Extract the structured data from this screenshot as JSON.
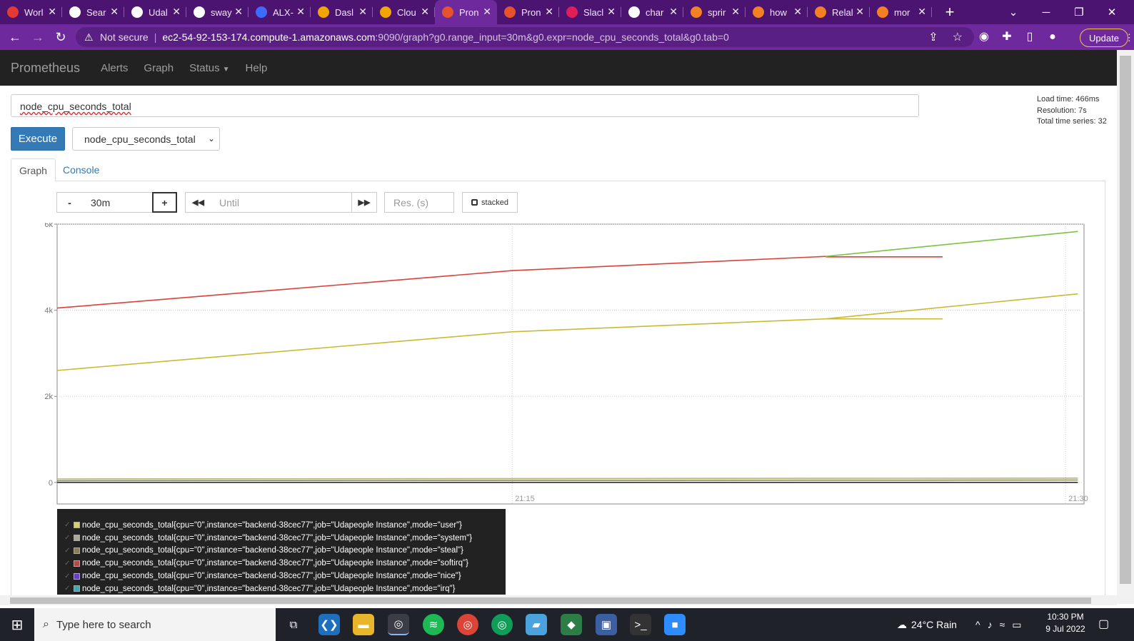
{
  "browser": {
    "tabs": [
      {
        "title": "Worl",
        "color": "#e53935",
        "active": false
      },
      {
        "title": "Sear",
        "color": "#ffffff",
        "active": false
      },
      {
        "title": "Udal",
        "color": "#ffffff",
        "active": false
      },
      {
        "title": "sway",
        "color": "#ffffff",
        "active": false
      },
      {
        "title": "ALX-",
        "color": "#3d6bff",
        "active": false
      },
      {
        "title": "Dasl",
        "color": "#f0a500",
        "active": false
      },
      {
        "title": "Clou",
        "color": "#f0a500",
        "active": false
      },
      {
        "title": "Pron",
        "color": "#e6522c",
        "active": true
      },
      {
        "title": "Pron",
        "color": "#e6522c",
        "active": false
      },
      {
        "title": "Slacl",
        "color": "#e01e5a",
        "active": false
      },
      {
        "title": "char",
        "color": "#ffffff",
        "active": false
      },
      {
        "title": "sprir",
        "color": "#f48024",
        "active": false
      },
      {
        "title": "how",
        "color": "#f48024",
        "active": false
      },
      {
        "title": "Relal",
        "color": "#f48024",
        "active": false
      },
      {
        "title": "mor",
        "color": "#f48024",
        "active": false
      }
    ],
    "tab_close": "✕",
    "new_tab": "+",
    "address": {
      "security": "Not secure",
      "host": "ec2-54-92-153-174.compute-1.amazonaws.com",
      "path": ":9090/graph?g0.range_input=30m&g0.expr=node_cpu_seconds_total&g0.tab=0"
    },
    "update_label": "Update"
  },
  "navbar": {
    "brand": "Prometheus",
    "links": [
      "Alerts",
      "Graph",
      "Status",
      "Help"
    ]
  },
  "query": {
    "expression": "node_cpu_seconds_total",
    "execute_label": "Execute",
    "metric_select": "node_cpu_seconds_total",
    "stats": {
      "load_time": "Load time: 466ms",
      "resolution": "Resolution: 7s",
      "total_series": "Total time series: 32"
    }
  },
  "tabs": {
    "graph": "Graph",
    "console": "Console"
  },
  "controls": {
    "minus": "-",
    "range": "30m",
    "plus": "+",
    "until_placeholder": "Until",
    "res_placeholder": "Res. (s)",
    "stacked_label": "stacked"
  },
  "chart_data": {
    "type": "line",
    "ylim": [
      -500,
      6000
    ],
    "xlim": [
      "21:02:40",
      "21:30:30"
    ],
    "y_ticks": [
      "0",
      "2k",
      "4k",
      "6k"
    ],
    "x_ticks": [
      "21:15",
      "21:30"
    ],
    "grid": true,
    "series": [
      {
        "color": "#d9413a",
        "points": [
          [
            "21:02:40",
            4050
          ],
          [
            "21:15",
            4920
          ],
          [
            "21:23:30",
            5250
          ]
        ]
      },
      {
        "color": "#d9413a",
        "points": [
          [
            "21:23:30",
            5240
          ],
          [
            "21:26:40",
            5240
          ]
        ]
      },
      {
        "color": "#7ec242",
        "points": [
          [
            "21:23:30",
            5250
          ],
          [
            "21:30:20",
            5830
          ]
        ]
      },
      {
        "color": "#c9b934",
        "points": [
          [
            "21:02:40",
            2600
          ],
          [
            "21:15",
            3500
          ],
          [
            "21:23:30",
            3800
          ],
          [
            "21:30:20",
            4380
          ]
        ]
      },
      {
        "color": "#c9b934",
        "points": [
          [
            "21:23:30",
            3800
          ],
          [
            "21:26:40",
            3800
          ]
        ]
      },
      {
        "color": "#b4b47a",
        "points": [
          [
            "21:02:40",
            80
          ],
          [
            "21:30:20",
            100
          ]
        ]
      },
      {
        "color": "#8a8a5a",
        "points": [
          [
            "21:02:40",
            40
          ],
          [
            "21:30:20",
            55
          ]
        ]
      },
      {
        "color": "#2e2e2e",
        "points": [
          [
            "21:02:40",
            0
          ],
          [
            "21:30:20",
            0
          ]
        ]
      }
    ]
  },
  "legend": [
    {
      "label": "node_cpu_seconds_total{cpu=\"0\",instance=\"backend-38cec77\",job=\"Udapeople Instance\",mode=\"user\"}",
      "color": "#d4cf7a"
    },
    {
      "label": "node_cpu_seconds_total{cpu=\"0\",instance=\"backend-38cec77\",job=\"Udapeople Instance\",mode=\"system\"}",
      "color": "#aaa897"
    },
    {
      "label": "node_cpu_seconds_total{cpu=\"0\",instance=\"backend-38cec77\",job=\"Udapeople Instance\",mode=\"steal\"}",
      "color": "#8b7e5a"
    },
    {
      "label": "node_cpu_seconds_total{cpu=\"0\",instance=\"backend-38cec77\",job=\"Udapeople Instance\",mode=\"softirq\"}",
      "color": "#b24b4b"
    },
    {
      "label": "node_cpu_seconds_total{cpu=\"0\",instance=\"backend-38cec77\",job=\"Udapeople Instance\",mode=\"nice\"}",
      "color": "#6a3fbf"
    },
    {
      "label": "node_cpu_seconds_total{cpu=\"0\",instance=\"backend-38cec77\",job=\"Udapeople Instance\",mode=\"irq\"}",
      "color": "#3fa7b5"
    }
  ],
  "taskbar": {
    "search_placeholder": "Type here to search",
    "weather": "24°C  Rain",
    "time": "10:30 PM",
    "date": "9 Jul 2022"
  }
}
